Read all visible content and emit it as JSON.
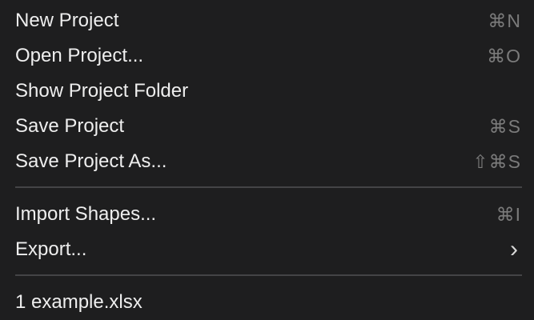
{
  "menu": {
    "items": [
      {
        "label": "New Project",
        "shortcut": "⌘N"
      },
      {
        "label": "Open Project...",
        "shortcut": "⌘O"
      },
      {
        "label": "Show Project Folder",
        "shortcut": ""
      },
      {
        "label": "Save Project",
        "shortcut": "⌘S"
      },
      {
        "label": "Save Project As...",
        "shortcut": "⇧⌘S"
      },
      {
        "label": "Import Shapes...",
        "shortcut": "⌘I"
      },
      {
        "label": "Export...",
        "submenu_icon": "›"
      },
      {
        "label": "1 example.xlsx",
        "shortcut": ""
      }
    ]
  },
  "colors": {
    "background": "#1e1e1f",
    "label": "#eeeeee",
    "shortcut": "#7b7b7b",
    "separator": "#444446"
  },
  "icons": {
    "command": "command-key-icon",
    "shift": "shift-key-icon",
    "submenu": "chevron-right-icon"
  }
}
